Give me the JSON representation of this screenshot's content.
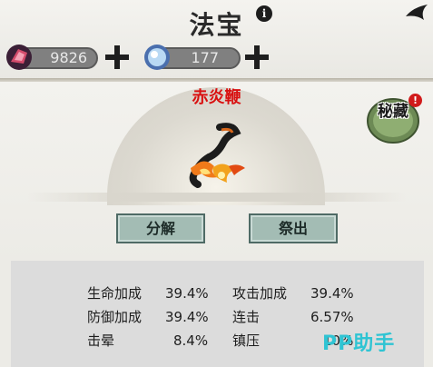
{
  "header": {
    "title": "法宝"
  },
  "currencies": [
    {
      "value": "9826",
      "icon": "red-gem-icon"
    },
    {
      "value": "177",
      "icon": "blue-orb-icon"
    }
  ],
  "item": {
    "name": "赤炎鞭",
    "icon": "flame-whip-icon",
    "name_color": "#d91010"
  },
  "secret_button": {
    "label": "秘藏",
    "badge": "!"
  },
  "actions": {
    "decompose_label": "分解",
    "deploy_label": "祭出"
  },
  "stats": [
    {
      "label": "生命加成",
      "value": "39.4%"
    },
    {
      "label": "攻击加成",
      "value": "39.4%"
    },
    {
      "label": "防御加成",
      "value": "39.4%"
    },
    {
      "label": "连击",
      "value": "6.57%"
    },
    {
      "label": "击晕",
      "value": "8.4%"
    },
    {
      "label": "镇压",
      "value": "10%"
    }
  ],
  "watermark": "PP助手",
  "colors": {
    "button_fill": "#a3bcb4",
    "button_border": "#4f6b66",
    "watermark": "#2fc4d3"
  }
}
